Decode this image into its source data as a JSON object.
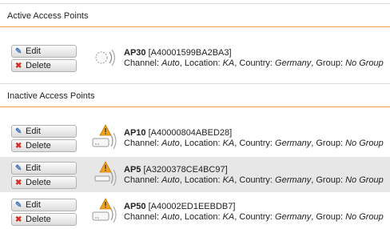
{
  "sections": {
    "active_title": "Active Access Points",
    "inactive_title": "Inactive Access Points"
  },
  "buttons": {
    "edit": "Edit",
    "delete": "Delete"
  },
  "labels": {
    "channel": "Channel:",
    "location": ", Location:",
    "country": ", Country:",
    "group": ", Group:"
  },
  "active_aps": [
    {
      "name": "AP30",
      "serial": "[A40001599BA2BA3]",
      "channel": "Auto",
      "location": "KA",
      "country": "Germany",
      "group": "No Group",
      "icon": "ap-ok-icon"
    }
  ],
  "inactive_aps": [
    {
      "name": "AP10",
      "serial": "[A40000804ABED28]",
      "channel": "Auto",
      "location": "KA",
      "country": "Germany",
      "group": "No Group",
      "icon": "ap-warning-icon"
    },
    {
      "name": "AP5",
      "serial": "[A3200378CE4BC97]",
      "channel": "Auto",
      "location": "KA",
      "country": "Germany",
      "group": "No Group",
      "icon": "ap-warning-icon"
    },
    {
      "name": "AP50",
      "serial": "[A40002ED1EEBDB7]",
      "channel": "Auto",
      "location": "KA",
      "country": "Germany",
      "group": "No Group",
      "icon": "ap-warning-icon"
    }
  ],
  "colors": {
    "header_rule": "#e8a04a",
    "alt_row": "#e7e7e7",
    "warning": "#f0a21e",
    "delete_icon": "#d3332b"
  }
}
